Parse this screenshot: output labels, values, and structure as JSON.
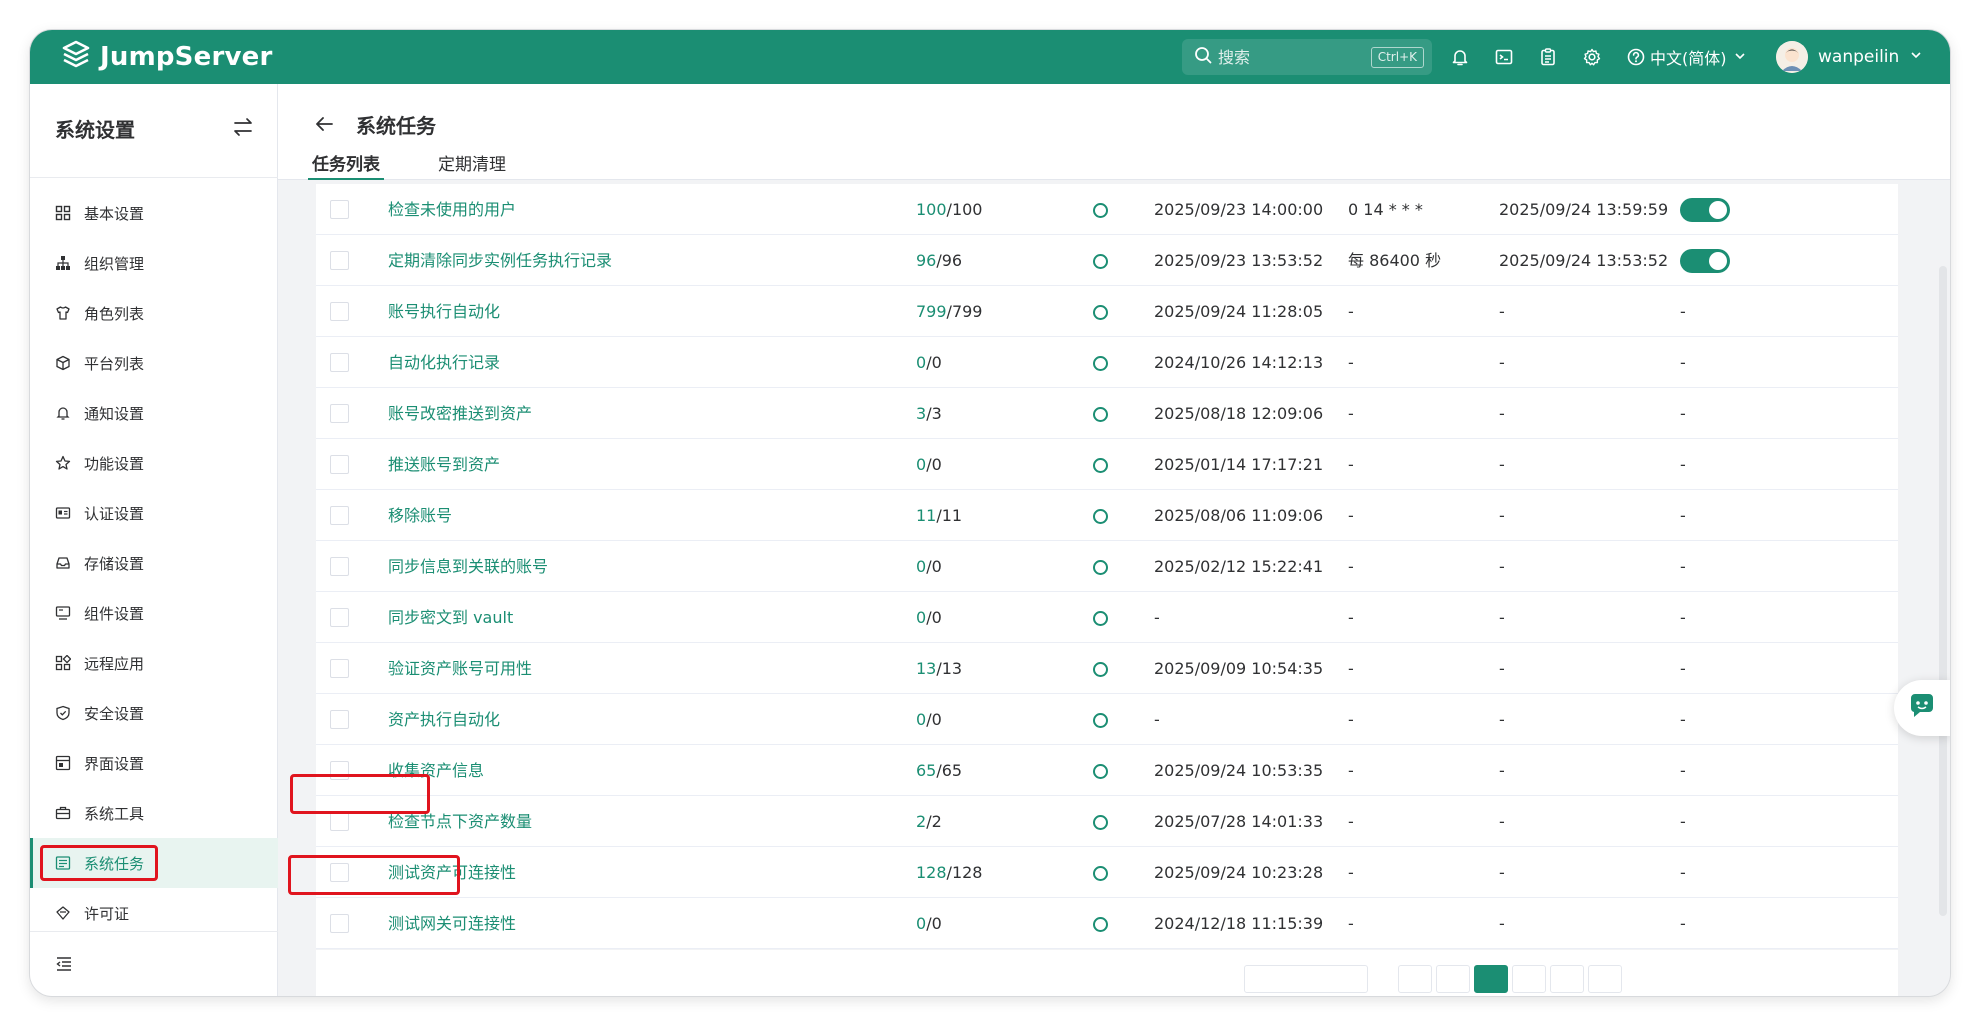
{
  "header": {
    "logo_text": "JumpServer",
    "search_placeholder": "搜索",
    "search_shortcut": "Ctrl+K",
    "language": "中文(简体)",
    "username": "wanpeilin"
  },
  "sidebar": {
    "title": "系统设置",
    "items": [
      {
        "label": "基本设置",
        "icon": "grid-icon"
      },
      {
        "label": "组织管理",
        "icon": "org-tree-icon"
      },
      {
        "label": "角色列表",
        "icon": "shirt-icon"
      },
      {
        "label": "平台列表",
        "icon": "cube-icon"
      },
      {
        "label": "通知设置",
        "icon": "bell-icon"
      },
      {
        "label": "功能设置",
        "icon": "star-icon"
      },
      {
        "label": "认证设置",
        "icon": "id-card-icon"
      },
      {
        "label": "存储设置",
        "icon": "inbox-icon"
      },
      {
        "label": "组件设置",
        "icon": "monitor-icon"
      },
      {
        "label": "远程应用",
        "icon": "apps-icon"
      },
      {
        "label": "安全设置",
        "icon": "shield-icon"
      },
      {
        "label": "界面设置",
        "icon": "layout-icon"
      },
      {
        "label": "系统工具",
        "icon": "toolbox-icon"
      },
      {
        "label": "系统任务",
        "icon": "task-list-icon"
      },
      {
        "label": "许可证",
        "icon": "license-icon"
      }
    ],
    "active_index": 13
  },
  "page": {
    "title": "系统任务",
    "tabs": [
      "任务列表",
      "定期清理"
    ],
    "active_tab": 0
  },
  "table": {
    "rows": [
      {
        "name": "检查未使用的用户",
        "success": "100",
        "total": "/100",
        "date_last": "2025/09/23 14:00:00",
        "crontab": "0 14 * * *",
        "next_run": "2025/09/24 13:59:59",
        "enabled": true
      },
      {
        "name": "定期清除同步实例任务执行记录",
        "success": "96",
        "total": "/96",
        "date_last": "2025/09/23 13:53:52",
        "crontab": "每 86400 秒",
        "next_run": "2025/09/24 13:53:52",
        "enabled": true
      },
      {
        "name": "账号执行自动化",
        "success": "799",
        "total": "/799",
        "date_last": "2025/09/24 11:28:05",
        "crontab": "-",
        "next_run": "-",
        "enabled": null,
        "switch_text": "-"
      },
      {
        "name": "自动化执行记录",
        "success": "0",
        "total": "/0",
        "date_last": "2024/10/26 14:12:13",
        "crontab": "-",
        "next_run": "-",
        "enabled": null,
        "switch_text": "-"
      },
      {
        "name": "账号改密推送到资产",
        "success": "3",
        "total": "/3",
        "date_last": "2025/08/18 12:09:06",
        "crontab": "-",
        "next_run": "-",
        "enabled": null,
        "switch_text": "-"
      },
      {
        "name": "推送账号到资产",
        "success": "0",
        "total": "/0",
        "date_last": "2025/01/14 17:17:21",
        "crontab": "-",
        "next_run": "-",
        "enabled": null,
        "switch_text": "-"
      },
      {
        "name": "移除账号",
        "success": "11",
        "total": "/11",
        "date_last": "2025/08/06 11:09:06",
        "crontab": "-",
        "next_run": "-",
        "enabled": null,
        "switch_text": "-"
      },
      {
        "name": "同步信息到关联的账号",
        "success": "0",
        "total": "/0",
        "date_last": "2025/02/12 15:22:41",
        "crontab": "-",
        "next_run": "-",
        "enabled": null,
        "switch_text": "-"
      },
      {
        "name": "同步密文到 vault",
        "success": "0",
        "total": "/0",
        "date_last": "-",
        "crontab": "-",
        "next_run": "-",
        "enabled": null,
        "switch_text": "-"
      },
      {
        "name": "验证资产账号可用性",
        "success": "13",
        "total": "/13",
        "date_last": "2025/09/09 10:54:35",
        "crontab": "-",
        "next_run": "-",
        "enabled": null,
        "switch_text": "-"
      },
      {
        "name": "资产执行自动化",
        "success": "0",
        "total": "/0",
        "date_last": "-",
        "crontab": "-",
        "next_run": "-",
        "enabled": null,
        "switch_text": "-"
      },
      {
        "name": "收集资产信息",
        "success": "65",
        "total": "/65",
        "date_last": "2025/09/24 10:53:35",
        "crontab": "-",
        "next_run": "-",
        "enabled": null,
        "switch_text": "-"
      },
      {
        "name": "检查节点下资产数量",
        "success": "2",
        "total": "/2",
        "date_last": "2025/07/28 14:01:33",
        "crontab": "-",
        "next_run": "-",
        "enabled": null,
        "switch_text": "-"
      },
      {
        "name": "测试资产可连接性",
        "success": "128",
        "total": "/128",
        "date_last": "2025/09/24 10:23:28",
        "crontab": "-",
        "next_run": "-",
        "enabled": null,
        "switch_text": "-"
      },
      {
        "name": "测试网关可连接性",
        "success": "0",
        "total": "/0",
        "date_last": "2024/12/18 11:15:39",
        "crontab": "-",
        "next_run": "-",
        "enabled": null,
        "switch_text": "-"
      }
    ]
  },
  "colors": {
    "brand": "#1b8e73",
    "highlight": "#e0141e"
  }
}
